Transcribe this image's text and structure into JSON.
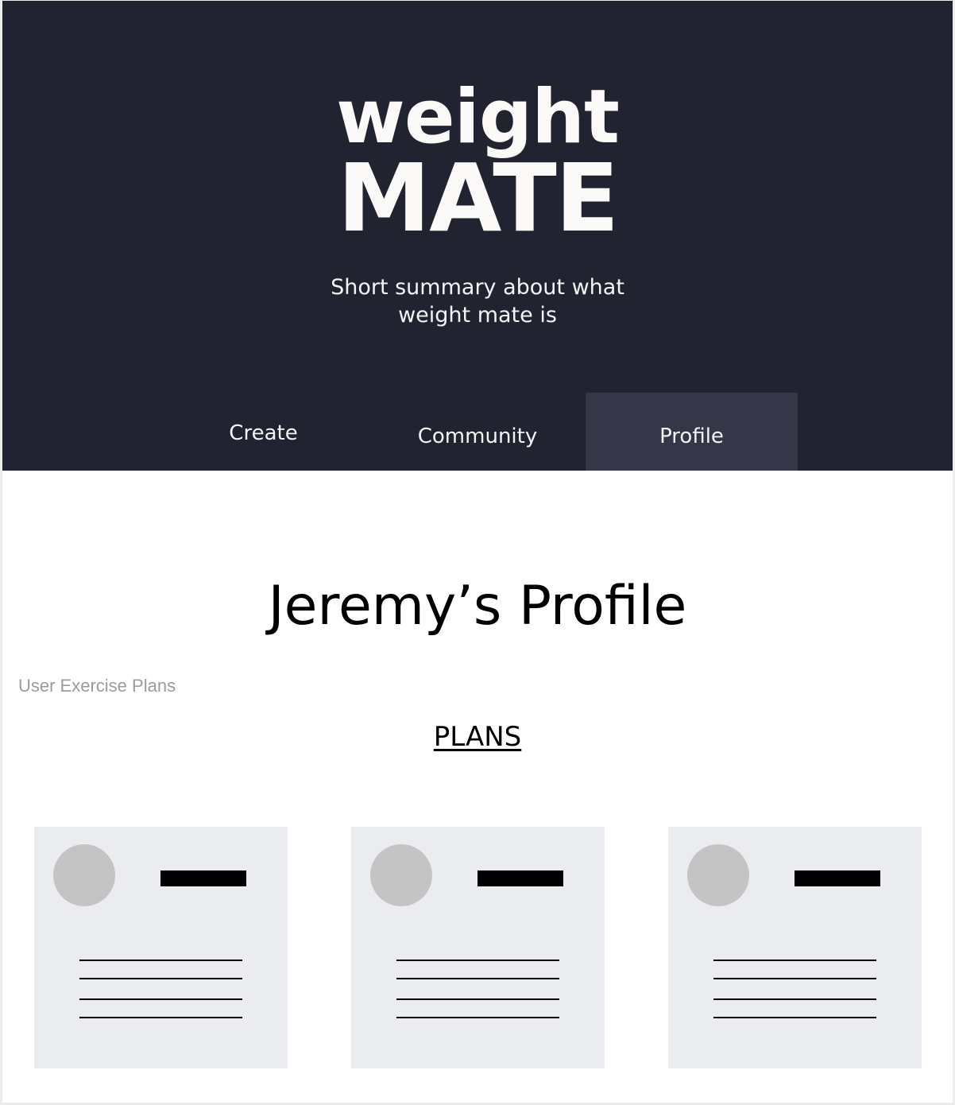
{
  "header": {
    "logo_top": "weight",
    "logo_bottom": "MATE",
    "summary": "Short summary about what weight mate is",
    "background_color": "#222330"
  },
  "nav": {
    "items": [
      {
        "label": "Create",
        "active": false
      },
      {
        "label": "Community",
        "active": false
      },
      {
        "label": "Profile",
        "active": true
      }
    ],
    "active_color": "#353748"
  },
  "main": {
    "title": "Jeremy’s Profile",
    "section_label": "User Exercise Plans",
    "plans_heading": "PLANS"
  },
  "plans": [
    {
      "type": "plan-card-placeholder"
    },
    {
      "type": "plan-card-placeholder"
    },
    {
      "type": "plan-card-placeholder"
    }
  ]
}
